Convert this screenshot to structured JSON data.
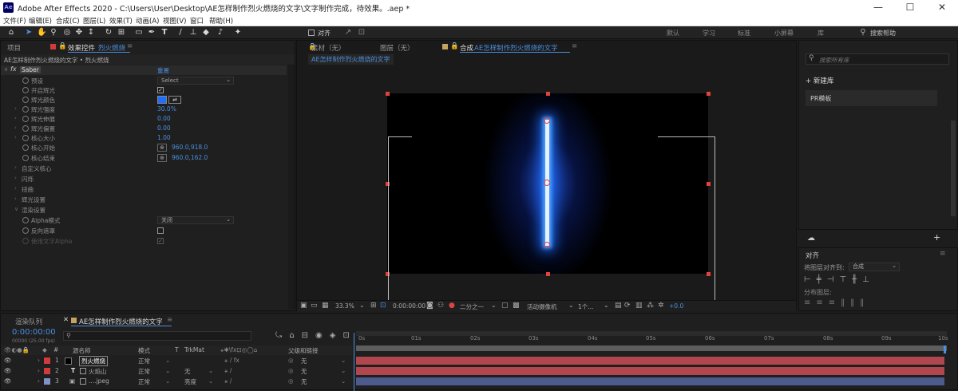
{
  "window": {
    "logo": "Ae",
    "title": "Adobe After Effects 2020 - C:\\Users\\User\\Desktop\\AE怎样制作烈火燃烧的文字\\文字制作完成，待效果。.aep *",
    "minimize": "—",
    "maximize": "☐",
    "close": "✕"
  },
  "menu": [
    "文件(F)",
    "编辑(E)",
    "合成(C)",
    "图层(L)",
    "效果(T)",
    "动画(A)",
    "视图(V)",
    "窗口",
    "帮助(H)"
  ],
  "toolbar": {
    "align_label": "对齐",
    "workspaces": [
      "默认",
      "学习",
      "标准",
      "小屏幕",
      "库"
    ],
    "help_search": "搜索帮助"
  },
  "left_panel": {
    "tab_project": "项目",
    "tab_effects": "效果控件",
    "tab_effects_layer": "烈火燃烧",
    "breadcrumb": "AE怎样制作烈火燃烧的文字 • 烈火燃烧",
    "fx_name": "Saber",
    "reset": "重置",
    "properties": [
      {
        "name": "预设",
        "value": "Select",
        "kind": "select"
      },
      {
        "name": "开启辉光",
        "value": "✓",
        "kind": "check"
      },
      {
        "name": "辉光颜色",
        "value": "",
        "kind": "color"
      },
      {
        "name": "辉光强度",
        "value": "30.0%",
        "kind": "value"
      },
      {
        "name": "辉光伸展",
        "value": "0.00",
        "kind": "value"
      },
      {
        "name": "辉光偏置",
        "value": "0.00",
        "kind": "value"
      },
      {
        "name": "核心大小",
        "value": "1.00",
        "kind": "value"
      },
      {
        "name": "核心开始",
        "value": "960.0,918.0",
        "kind": "point"
      },
      {
        "name": "核心结束",
        "value": "960.0,162.0",
        "kind": "point"
      },
      {
        "name": "自定义核心",
        "value": "",
        "kind": "group"
      },
      {
        "name": "闪烁",
        "value": "",
        "kind": "group"
      },
      {
        "name": "扭曲",
        "value": "",
        "kind": "group"
      },
      {
        "name": "辉光设置",
        "value": "",
        "kind": "group"
      },
      {
        "name": "渲染设置",
        "value": "",
        "kind": "group"
      },
      {
        "name": "Alpha模式",
        "value": "关闭",
        "kind": "select"
      },
      {
        "name": "反向遮罩",
        "value": "",
        "kind": "check"
      },
      {
        "name": "使用文字Alpha",
        "value": "✓",
        "kind": "check"
      }
    ],
    "glow_color": "#1e6fff"
  },
  "viewer": {
    "tab_footage": "素材（无）",
    "tab_layer": "图层（无）",
    "tab_comp_prefix": "合成",
    "tab_comp": "AE怎样制作烈火燃烧的文字",
    "sub_tab": "AE怎样制作烈火燃烧的文字",
    "zoom": "33.3%",
    "timecode": "0:00:00:00",
    "resolution": "二分之一",
    "camera": "活动摄像机",
    "views": "1个...",
    "exposure": "+0.0"
  },
  "right_panel": {
    "search_placeholder": "搜索所有库",
    "new_library": "+ 新建库",
    "library_item": "PR模板",
    "align_title": "对齐",
    "align_to_label": "将图层对齐到:",
    "align_to_value": "合成",
    "distribute_label": "分布图层:"
  },
  "timeline": {
    "tab_render": "渲染队列",
    "tab_comp": "AE怎样制作烈火燃烧的文字",
    "timecode": "0:00:00:00",
    "frames": "00000 (25.00 fps)",
    "headers": {
      "num": "#",
      "name": "源名称",
      "mode": "模式",
      "t": "T",
      "trkmat": "TrkMat",
      "parent": "父级和链接"
    },
    "ruler": [
      "0s",
      "01s",
      "02s",
      "03s",
      "04s",
      "05s",
      "06s",
      "07s",
      "08s",
      "09s",
      "10s"
    ],
    "layers": [
      {
        "num": "1",
        "name": "烈火燃烧",
        "mode": "正常",
        "trkmat": "",
        "parent": "无",
        "color": "#b0474f"
      },
      {
        "num": "2",
        "name": "火焰山",
        "mode": "正常",
        "trkmat": "无",
        "parent": "无",
        "color": "#b0474f"
      },
      {
        "num": "3",
        "name": "....jpeg",
        "mode": "正常",
        "trkmat": "亮度",
        "parent": "无",
        "color": "#4d5a8c"
      }
    ]
  }
}
